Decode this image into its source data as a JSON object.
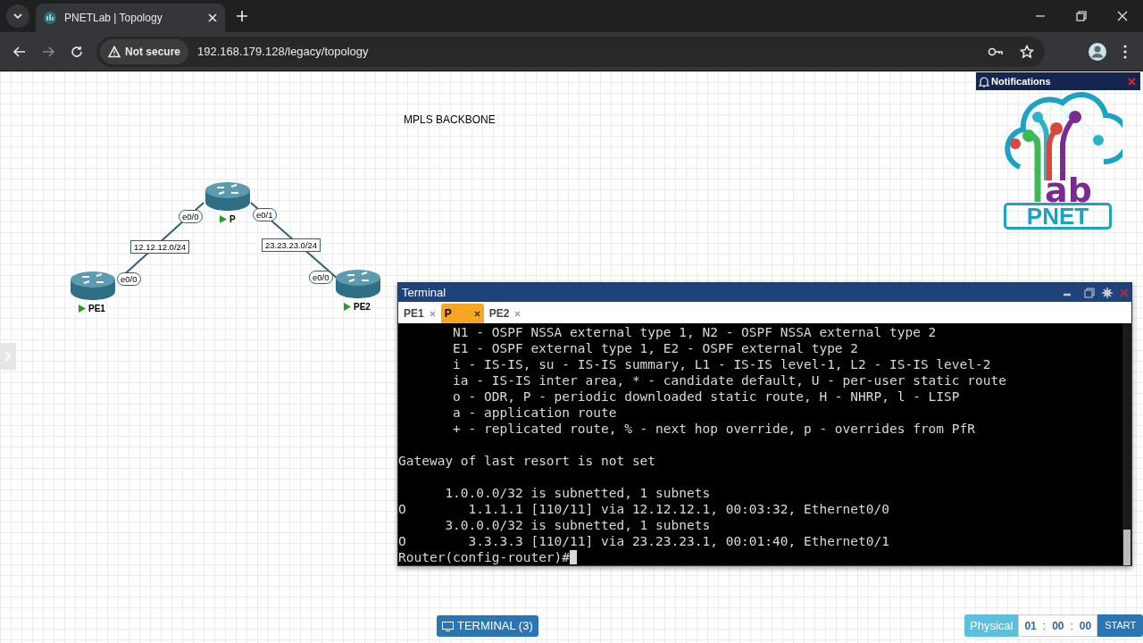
{
  "browser": {
    "tab_title": "PNETLab | Topology",
    "security": "Not secure",
    "url": "192.168.179.128/legacy/topology"
  },
  "notifications": {
    "title": "Notifications"
  },
  "logo": {
    "word": "ab",
    "brand": "PNET"
  },
  "canvas_label": "MPLS BACKBONE",
  "nodes": [
    {
      "name": "P",
      "running": true
    },
    {
      "name": "PE1",
      "running": true
    },
    {
      "name": "PE2",
      "running": true
    }
  ],
  "links": [
    {
      "subnet": "12.12.12.0/24",
      "from_interface": "e0/0",
      "to_interface": "e0/0"
    },
    {
      "subnet": "23.23.23.0/24",
      "from_interface": "e0/1",
      "to_interface": "e0/0"
    }
  ],
  "terminal": {
    "title": "Terminal",
    "tabs": [
      {
        "label": "PE1",
        "selected": false
      },
      {
        "label": "P",
        "selected": true
      },
      {
        "label": "PE2",
        "selected": false
      }
    ],
    "lines": [
      {
        "kind": "text",
        "text": "       N1 - OSPF NSSA external type 1, N2 - OSPF NSSA external type 2"
      },
      {
        "kind": "text",
        "text": "       E1 - OSPF external type 1, E2 - OSPF external type 2"
      },
      {
        "kind": "text",
        "text": "       i - IS-IS, su - IS-IS summary, L1 - IS-IS level-1, L2 - IS-IS level-2"
      },
      {
        "kind": "text",
        "text": "       ia - IS-IS inter area, * - candidate default, U - per-user static route"
      },
      {
        "kind": "text",
        "text": "       o - ODR, P - periodic downloaded static route, H - NHRP, l - LISP"
      },
      {
        "kind": "text",
        "text": "       a - application route"
      },
      {
        "kind": "text",
        "text": "       + - replicated route, % - next hop override, p - overrides from PfR"
      },
      {
        "kind": "blank"
      },
      {
        "kind": "text",
        "text": "Gateway of last resort is not set"
      },
      {
        "kind": "blank"
      },
      {
        "kind": "text",
        "text": "      1.0.0.0/32 is subnetted, 1 subnets"
      },
      {
        "kind": "text",
        "text": "O        1.1.1.1 [110/11] via 12.12.12.1, 00:03:32, Ethernet0/0"
      },
      {
        "kind": "text",
        "text": "      3.0.0.0/32 is subnetted, 1 subnets"
      },
      {
        "kind": "text",
        "text": "O        3.3.3.3 [110/11] via 23.23.23.1, 00:01:40, Ethernet0/1"
      }
    ],
    "prompt": "Router(config-router)#"
  },
  "bottom_bar": {
    "terminal_button": "TERMINAL (3)",
    "mode": "Physical",
    "timer": [
      "01",
      ":",
      "00",
      ":",
      "00"
    ],
    "start_button": "START"
  }
}
